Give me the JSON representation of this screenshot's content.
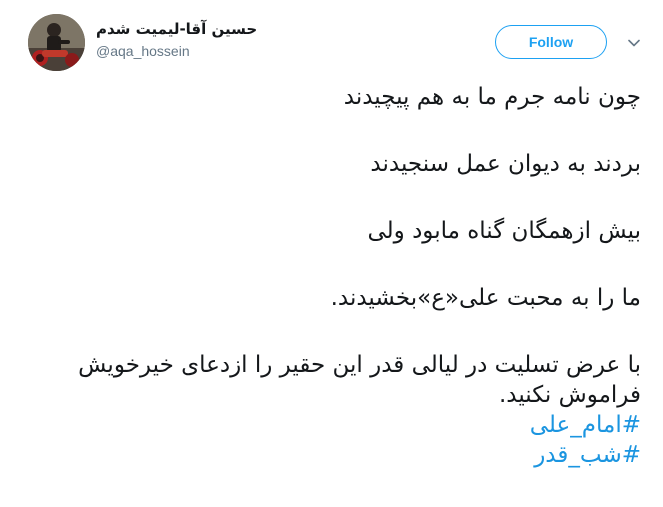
{
  "user": {
    "display_name": "حسین آقا-لیمیت شدم",
    "handle": "@aqa_hossein",
    "avatar_icon": "user-avatar-photo"
  },
  "actions": {
    "follow_label": "Follow",
    "menu_icon": "chevron-down-icon"
  },
  "tweet": {
    "lines": [
      "چون نامه جرم ما به هم پیچیدند",
      "بردند به دیوان عمل سنجیدند",
      "بیش ازهمگان گناه مابود ولی",
      "ما را به محبت علی«ع»بخشیدند.",
      "با عرض تسلیت در لیالی قدر این حقیر را ازدعای خیرخویش فراموش نکنید."
    ],
    "hashtags": [
      "#امام_علی",
      "#شب_قدر"
    ]
  },
  "colors": {
    "accent": "#1da1f2",
    "link": "#1b95e0",
    "text": "#14171a",
    "muted": "#657786"
  }
}
